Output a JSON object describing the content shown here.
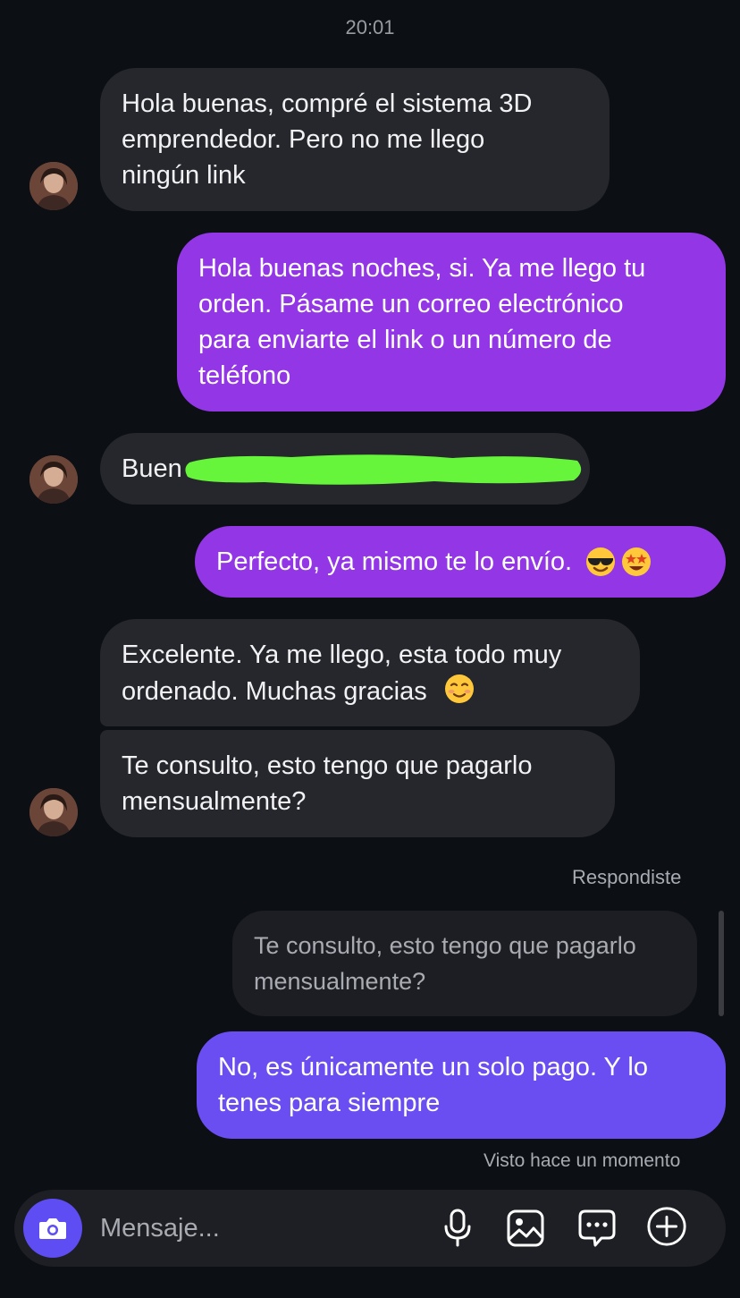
{
  "header": {
    "timestamp": "20:01"
  },
  "messages": [
    {
      "direction": "incoming",
      "lines": [
        "Hola buenas, compré el sistema 3D",
        "emprendedor. Pero no me llego",
        "ningún link"
      ]
    },
    {
      "direction": "outgoing",
      "lines": [
        "Hola buenas noches, si. Ya me llego tu",
        "orden. Pásame un correo electrónico",
        "para enviarte el link o un número de",
        "teléfono"
      ]
    },
    {
      "direction": "incoming",
      "text": "Buen",
      "redaction_color": "#66f53a"
    },
    {
      "direction": "outgoing",
      "text": "Perfecto, ya mismo te lo envío.",
      "emojis": [
        "smiling-face-with-sunglasses",
        "star-struck"
      ]
    },
    {
      "direction": "incoming",
      "lines": [
        "Excelente. Ya me llego, esta todo muy",
        "ordenado. Muchas gracias"
      ],
      "emojis": [
        "smiling-face"
      ]
    },
    {
      "direction": "incoming",
      "lines": [
        "Te consulto, esto tengo que pagarlo",
        "mensualmente?"
      ]
    },
    {
      "direction": "outgoing",
      "reply_label": "Respondiste",
      "quoted_lines": [
        "Te consulto, esto tengo que pagarlo",
        "mensualmente?"
      ],
      "lines": [
        "No, es únicamente un solo pago. Y lo",
        "tenes para siempre"
      ],
      "status": "Visto hace un momento"
    }
  ],
  "composer": {
    "placeholder": "Mensaje...",
    "icons": [
      "camera-icon",
      "microphone-icon",
      "gallery-icon",
      "sticker-icon",
      "add-icon"
    ]
  },
  "colors": {
    "background": "#0c0f14",
    "incoming_bubble": "#25272d",
    "outgoing_purple": "#9337e6",
    "outgoing_violet": "#6a4ef2",
    "camera_button": "#5d4df2"
  }
}
